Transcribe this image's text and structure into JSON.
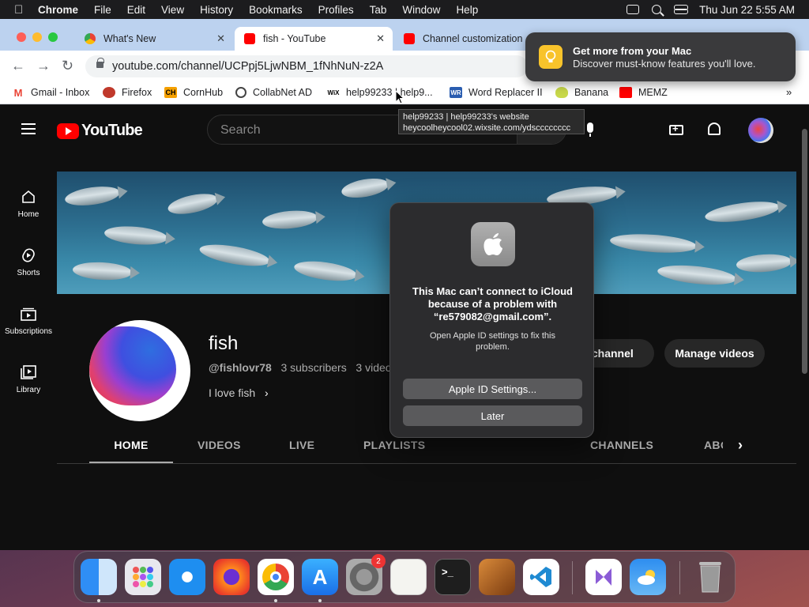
{
  "menubar": {
    "app": "Chrome",
    "items": [
      "File",
      "Edit",
      "View",
      "History",
      "Bookmarks",
      "Profiles",
      "Tab",
      "Window",
      "Help"
    ],
    "datetime": "Thu Jun 22  5:55 AM"
  },
  "tabs": [
    {
      "title": "What's New",
      "favicon": "chrome-icon"
    },
    {
      "title": "fish - YouTube",
      "favicon": "youtube-icon",
      "active": true
    },
    {
      "title": "Channel customization",
      "favicon": "youtube-icon"
    }
  ],
  "address": {
    "url": "youtube.com/channel/UCPpj5LjwNBM_1fNhNuN-z2A"
  },
  "bookmarks": [
    {
      "label": "Gmail - Inbox",
      "icon": "gmail-icon"
    },
    {
      "label": "Firefox",
      "icon": "firefox-icon"
    },
    {
      "label": "CornHub",
      "icon": "cornhub-icon",
      "glyph": "CH"
    },
    {
      "label": "CollabNet AD",
      "icon": "collabnet-icon"
    },
    {
      "label": "help99233 | help9...",
      "icon": "wix-icon",
      "glyph": "WiX"
    },
    {
      "label": "Word Replacer II",
      "icon": "word-replacer-icon",
      "glyph": "WR"
    },
    {
      "label": "Banana",
      "icon": "banana-icon"
    },
    {
      "label": "MEMZ",
      "icon": "youtube-icon"
    }
  ],
  "tooltip": {
    "line1": "help99233 | help99233's website",
    "line2": "heycoolheycool02.wixsite.com/ydscccccccc"
  },
  "notification": {
    "title": "Get more from your Mac",
    "body": "Discover must-know features you'll love."
  },
  "youtube": {
    "logo_text": "YouTube",
    "search_placeholder": "Search",
    "sidebar": [
      {
        "label": "Home",
        "icon": "home-icon"
      },
      {
        "label": "Shorts",
        "icon": "shorts-icon"
      },
      {
        "label": "Subscriptions",
        "icon": "subscriptions-icon"
      },
      {
        "label": "Library",
        "icon": "library-icon"
      }
    ],
    "channel": {
      "name": "fish",
      "handle": "@fishlovr78",
      "subscribers": "3 subscribers",
      "videos": "3 videos",
      "description": "I love fish"
    },
    "buttons": {
      "customize": "Customize channel",
      "manage": "Manage videos"
    },
    "tabs": [
      "HOME",
      "VIDEOS",
      "LIVE",
      "PLAYLISTS",
      "CHANNELS",
      "ABOUT"
    ]
  },
  "dialog": {
    "title": "This Mac can’t connect to iCloud because of a problem with “re579082@gmail.com”.",
    "body": "Open Apple ID settings to fix this problem.",
    "primary": "Apple ID Settings...",
    "secondary": "Later"
  },
  "dock": {
    "apps": [
      "finder-icon",
      "launchpad-icon",
      "safari-icon",
      "firefox-icon",
      "chrome-icon",
      "app-store-icon",
      "system-settings-icon",
      "textedit-icon",
      "terminal-icon",
      "garageband-icon",
      "vscode-icon",
      "visual-studio-icon",
      "weather-icon",
      "trash-icon"
    ],
    "settings_badge": "2"
  },
  "colors": {
    "youtube_red": "#ff0000",
    "tabstrip": "#bcd2ef",
    "dialog_bg": "#2c2c2e"
  }
}
